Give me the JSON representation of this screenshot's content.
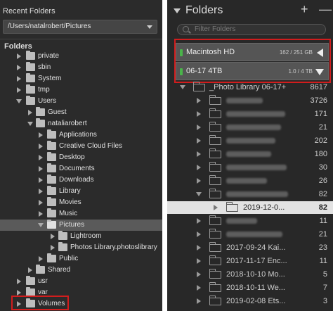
{
  "left_panel": {
    "recent_header": "Recent Folders",
    "path": "/Users/natalrobert/Pictures",
    "folders_header": "Folders",
    "tree": [
      {
        "label": "private"
      },
      {
        "label": "sbin"
      },
      {
        "label": "System"
      },
      {
        "label": "tmp"
      },
      {
        "label": "Users"
      },
      {
        "label": "Guest"
      },
      {
        "label": "nataliarobert"
      },
      {
        "label": "Applications"
      },
      {
        "label": "Creative Cloud Files"
      },
      {
        "label": "Desktop"
      },
      {
        "label": "Documents"
      },
      {
        "label": "Downloads"
      },
      {
        "label": "Library"
      },
      {
        "label": "Movies"
      },
      {
        "label": "Music"
      },
      {
        "label": "Pictures"
      },
      {
        "label": "Lightroom"
      },
      {
        "label": "Photos Library.photoslibrary"
      },
      {
        "label": "Public"
      },
      {
        "label": "Shared"
      },
      {
        "label": "usr"
      },
      {
        "label": "var"
      },
      {
        "label": "Volumes"
      }
    ]
  },
  "right_panel": {
    "title": "Folders",
    "plus": "+",
    "minus": "—",
    "filter_placeholder": "Filter Folders",
    "volumes": [
      {
        "name": "Macintosh HD",
        "size": "162 / 251 GB"
      },
      {
        "name": "06-17 4TB",
        "size": "1.0 / 4 TB"
      }
    ],
    "rows": [
      {
        "name": "_Photo Library 06-17+",
        "count": "8617"
      },
      {
        "name": "",
        "count": "3726"
      },
      {
        "name": "",
        "count": "171"
      },
      {
        "name": "",
        "count": "21"
      },
      {
        "name": "",
        "count": "202"
      },
      {
        "name": "",
        "count": "180"
      },
      {
        "name": "",
        "count": "30"
      },
      {
        "name": "",
        "count": "26"
      },
      {
        "name": "",
        "count": "82"
      },
      {
        "name": "2019-12-0...",
        "count": "82"
      },
      {
        "name": "",
        "count": "11"
      },
      {
        "name": "",
        "count": "21"
      },
      {
        "name": "2017-09-24 Kai...",
        "count": "23"
      },
      {
        "name": "2017-11-17 Enc...",
        "count": "11"
      },
      {
        "name": "2018-10-10 Mo...",
        "count": "5"
      },
      {
        "name": "2018-10-11 We...",
        "count": "7"
      },
      {
        "name": "2019-02-08 Ets...",
        "count": "3"
      }
    ]
  },
  "colors": {
    "highlight_red": "#d11d1d",
    "selected_row": "#e2e2e2",
    "drive_led": "#4ab44a"
  }
}
